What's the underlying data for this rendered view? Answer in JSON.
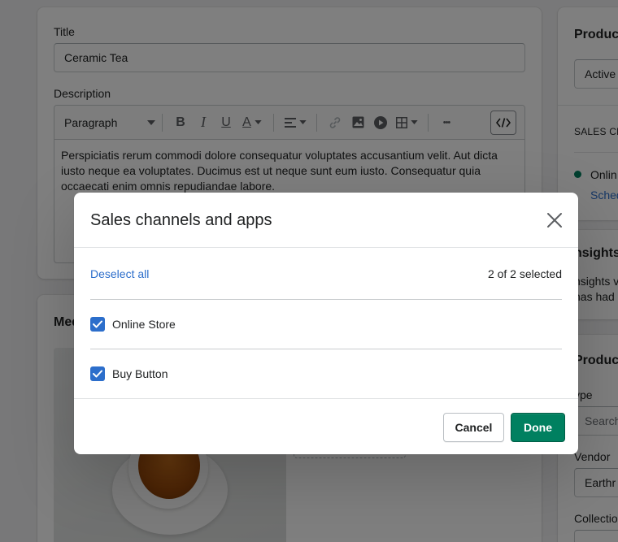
{
  "product": {
    "title_label": "Title",
    "title_value": "Ceramic Tea",
    "description_label": "Description",
    "toolbar": {
      "paragraph_select": "Paragraph",
      "bold": "B",
      "italic": "I",
      "underline": "U",
      "text_color": "A",
      "more": "•••"
    },
    "description_text": "Perspiciatis rerum commodi dolore consequatur voluptates accusantium velit. Aut dicta iusto neque ea voluptates. Ducimus est ut neque sunt eum iusto. Consequatur quia occaecati enim omnis repudiandae labore.",
    "media_label": "Med"
  },
  "sidebar": {
    "status_title": "Product",
    "status_value": "Active",
    "sales_channels_heading": "SALES CHA",
    "online_store_fragment": "Onlin",
    "schedule_fragment": "Sched",
    "insights_title": "nsights",
    "insights_line1": "nsights v",
    "insights_line2": "nas had n",
    "organization_title": "Product",
    "type_label": "ype",
    "type_placeholder": "Search",
    "vendor_label": "Vendor",
    "vendor_value": "Earthr",
    "collections_label": "Collection"
  },
  "modal": {
    "title": "Sales channels and apps",
    "deselect_all": "Deselect all",
    "selected_count": "2 of 2 selected",
    "channels": [
      {
        "label": "Online Store",
        "checked": true
      },
      {
        "label": "Buy Button",
        "checked": true
      }
    ],
    "cancel_label": "Cancel",
    "done_label": "Done"
  },
  "colors": {
    "accent": "#2c6ecb",
    "primary": "#008060",
    "status_dot": "#007f5f"
  }
}
